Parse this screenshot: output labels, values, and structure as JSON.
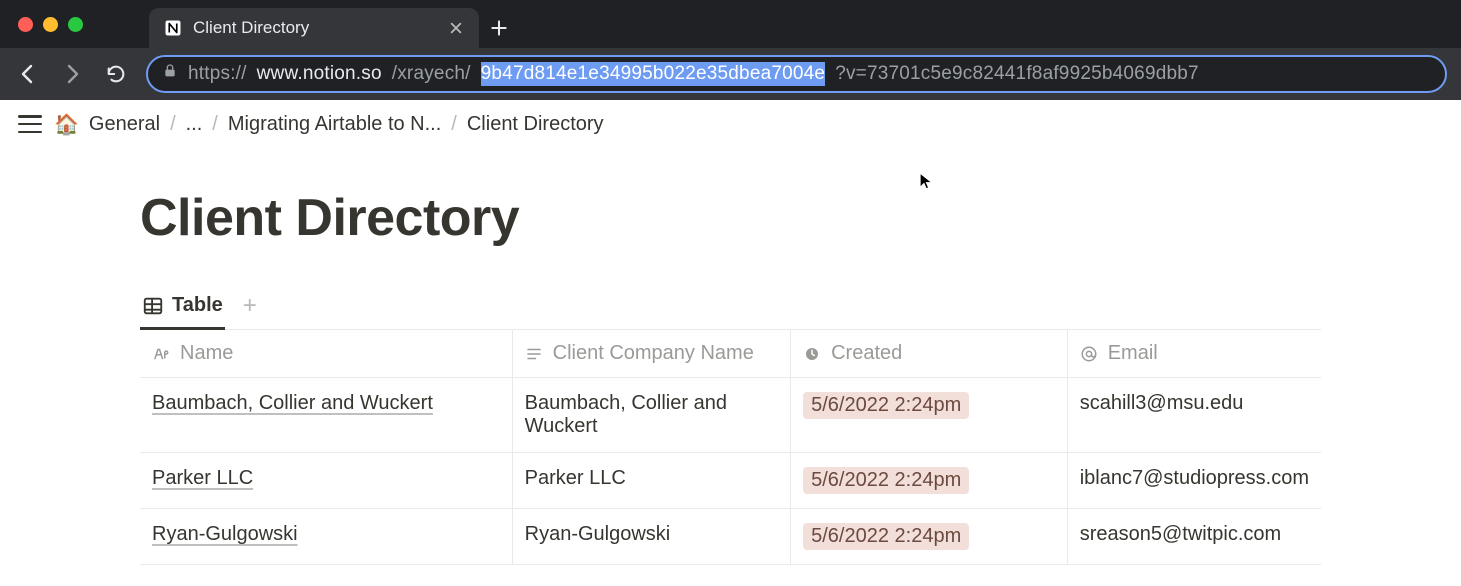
{
  "browser": {
    "tab_title": "Client Directory",
    "url": {
      "scheme": "https://",
      "host": "www.notion.so",
      "path_dim1": "/xrayech/",
      "path_selected": "9b47d814e1e34995b022e35dbea7004e",
      "query_dim": "?v=73701c5e9c82441f8af9925b4069dbb7"
    }
  },
  "notion": {
    "breadcrumb": {
      "emoji": "🏠",
      "root": "General",
      "ellipsis": "...",
      "mid": "Migrating Airtable to N...",
      "leaf": "Client Directory"
    },
    "page_title": "Client Directory",
    "view_tab_label": "Table",
    "columns": {
      "name": "Name",
      "company": "Client Company Name",
      "created": "Created",
      "email": "Email"
    },
    "rows": [
      {
        "name": "Baumbach, Collier and Wuckert",
        "company": "Baumbach, Collier and Wuckert",
        "created": "5/6/2022 2:24pm",
        "email": "scahill3@msu.edu"
      },
      {
        "name": "Parker LLC",
        "company": "Parker LLC",
        "created": "5/6/2022 2:24pm",
        "email": "iblanc7@studiopress.com"
      },
      {
        "name": "Ryan-Gulgowski",
        "company": "Ryan-Gulgowski",
        "created": "5/6/2022 2:24pm",
        "email": "sreason5@twitpic.com"
      }
    ]
  }
}
